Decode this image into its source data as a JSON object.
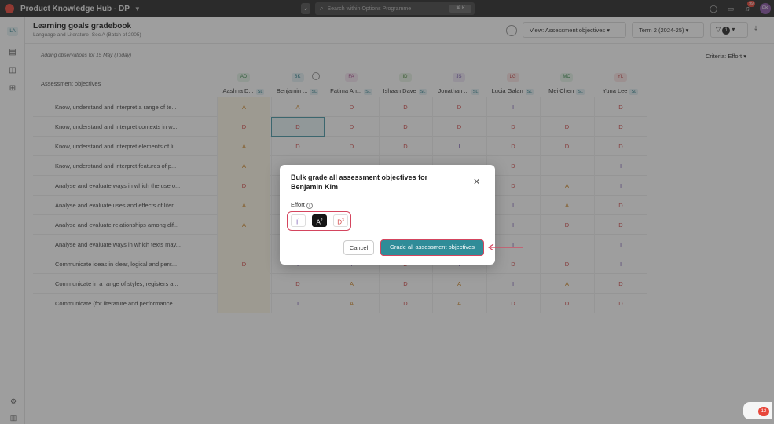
{
  "app": {
    "title": "Product Knowledge Hub - DP",
    "search_placeholder": "Search within Options Programme",
    "search_shortcut": "⌘ K",
    "notif_count": "99",
    "avatar": "PK"
  },
  "sidebar": {
    "badge": "LA"
  },
  "header": {
    "title": "Learning goals gradebook",
    "subtitle": "Language and Literature- Sec A (Batch of 2005)",
    "view_label": "View: Assessment objectives",
    "term_label": "Term 2 (2024-25)",
    "filter_count": "1"
  },
  "obs_note": "Adding observations for 15 May (Today)",
  "criteria": "Criteria: Effort",
  "table": {
    "header_label": "Assessment objectives",
    "students": [
      {
        "initials": "AD",
        "name": "Aashna D...",
        "bg": "#e6f4ea",
        "fg": "#3a8a4c"
      },
      {
        "initials": "BK",
        "name": "Benjamin ...",
        "bg": "#e3f1f4",
        "fg": "#2b7d8b"
      },
      {
        "initials": "FA",
        "name": "Fatima Ah...",
        "bg": "#f6e7f2",
        "fg": "#a84b8c"
      },
      {
        "initials": "ID",
        "name": "Ishaan Dave",
        "bg": "#e8f3e6",
        "fg": "#4a8a3a"
      },
      {
        "initials": "JS",
        "name": "Jonathan ...",
        "bg": "#eee8f6",
        "fg": "#6b4fa8"
      },
      {
        "initials": "LG",
        "name": "Lucia Galan",
        "bg": "#fbe6e6",
        "fg": "#c44848"
      },
      {
        "initials": "MC",
        "name": "Mei Chen",
        "bg": "#e6f4ea",
        "fg": "#3a8a4c"
      },
      {
        "initials": "YL",
        "name": "Yuna Lee",
        "bg": "#fbe6e6",
        "fg": "#c44848"
      }
    ],
    "sl_tag": "SL",
    "rows": [
      {
        "label": "Know, understand and interpret a range of te...",
        "grades": [
          "A",
          "A",
          "D",
          "D",
          "D",
          "I",
          "I",
          "D"
        ]
      },
      {
        "label": "Know, understand and interpret contexts in w...",
        "grades": [
          "D",
          "D",
          "D",
          "D",
          "D",
          "D",
          "D",
          "D"
        ]
      },
      {
        "label": "Know, understand and interpret elements of li...",
        "grades": [
          "A",
          "D",
          "D",
          "D",
          "I",
          "D",
          "D",
          "D"
        ]
      },
      {
        "label": "Know, understand and interpret features of p...",
        "grades": [
          "A",
          "",
          "",
          "",
          "",
          "D",
          "I",
          "I"
        ]
      },
      {
        "label": "Analyse and evaluate ways in which the use o...",
        "grades": [
          "D",
          "",
          "",
          "",
          "",
          "D",
          "A",
          "I"
        ]
      },
      {
        "label": "Analyse and evaluate uses and effects of liter...",
        "grades": [
          "A",
          "",
          "",
          "",
          "",
          "I",
          "A",
          "D"
        ]
      },
      {
        "label": "Analyse and evaluate relationships among dif...",
        "grades": [
          "A",
          "",
          "",
          "",
          "",
          "I",
          "D",
          "D"
        ]
      },
      {
        "label": "Analyse and evaluate ways in which texts may...",
        "grades": [
          "I",
          "",
          "",
          "",
          "",
          "I",
          "I",
          "I"
        ]
      },
      {
        "label": "Communicate ideas in clear, logical and pers...",
        "grades": [
          "D",
          "I",
          "I",
          "D",
          "I",
          "D",
          "D",
          "I"
        ]
      },
      {
        "label": "Communicate in a range of styles, registers a...",
        "grades": [
          "I",
          "D",
          "A",
          "D",
          "A",
          "I",
          "A",
          "D"
        ]
      },
      {
        "label": "Communicate (for literature and performance...",
        "grades": [
          "I",
          "I",
          "A",
          "D",
          "A",
          "D",
          "D",
          "D"
        ]
      }
    ]
  },
  "modal": {
    "title": "Bulk grade all assessment objectives for Benjamin Kim",
    "effort_label": "Effort",
    "grades": [
      {
        "letter": "I",
        "sup": "1",
        "active": false,
        "color": "#7a5bb4"
      },
      {
        "letter": "A",
        "sup": "2",
        "active": true,
        "color": "#ffffff"
      },
      {
        "letter": "D",
        "sup": "3",
        "active": false,
        "color": "#d24a4a"
      }
    ],
    "cancel_label": "Cancel",
    "confirm_label": "Grade all assessment objectives"
  },
  "chat_count": "12"
}
